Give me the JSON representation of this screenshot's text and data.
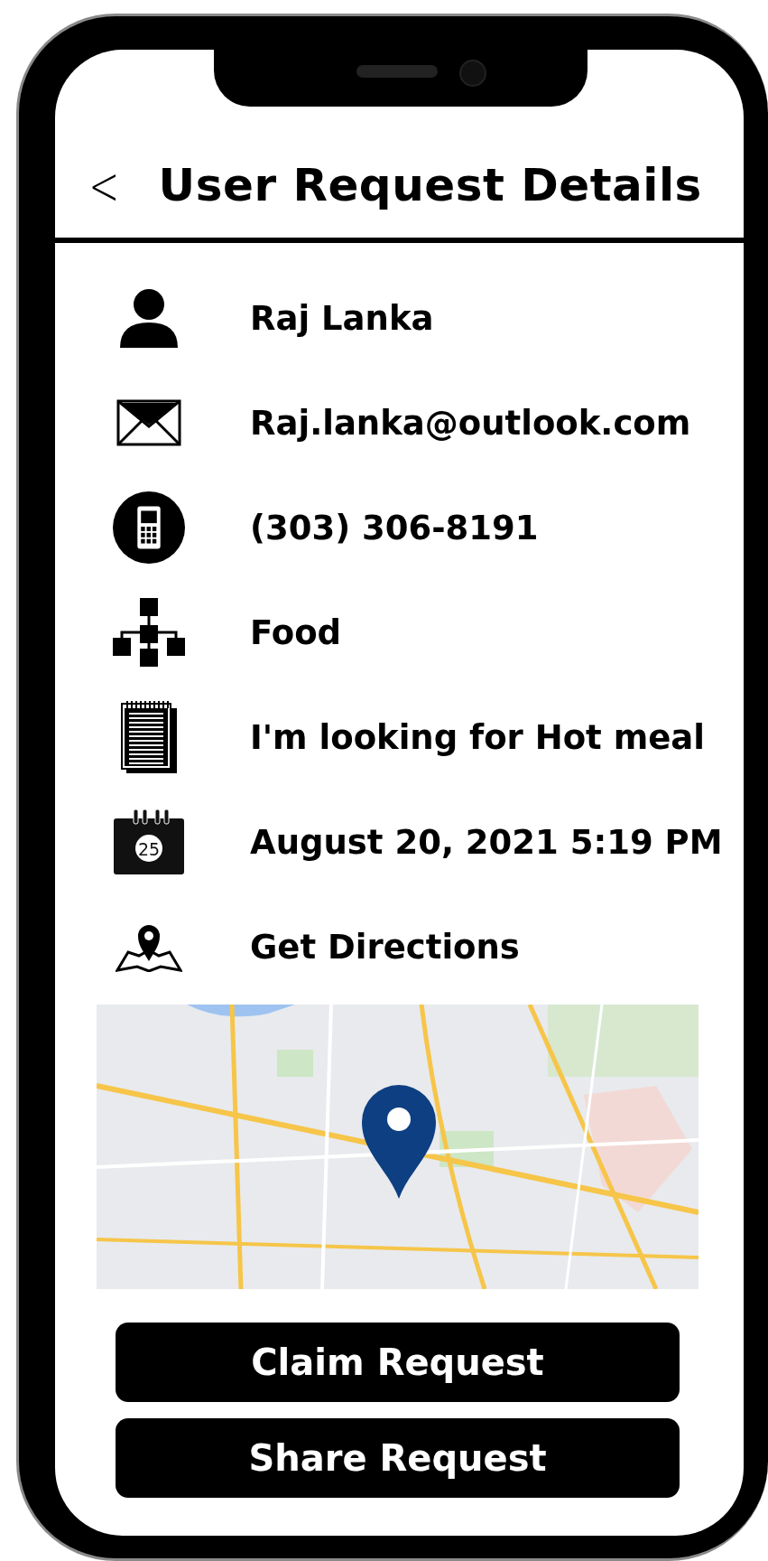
{
  "header": {
    "back": "<",
    "title": "User Request Details"
  },
  "details": [
    {
      "kind": "person",
      "text": "Raj Lanka"
    },
    {
      "kind": "email",
      "text": "Raj.lanka@outlook.com"
    },
    {
      "kind": "phone",
      "text": "(303) 306-8191"
    },
    {
      "kind": "category",
      "text": "Food"
    },
    {
      "kind": "note",
      "text": "I'm looking for Hot meal"
    },
    {
      "kind": "date",
      "text": "August 20, 2021 5:19 PM",
      "icon_day": "25"
    },
    {
      "kind": "directions",
      "text": "Get Directions"
    }
  ],
  "buttons": [
    "Claim Request",
    "Share Request"
  ]
}
